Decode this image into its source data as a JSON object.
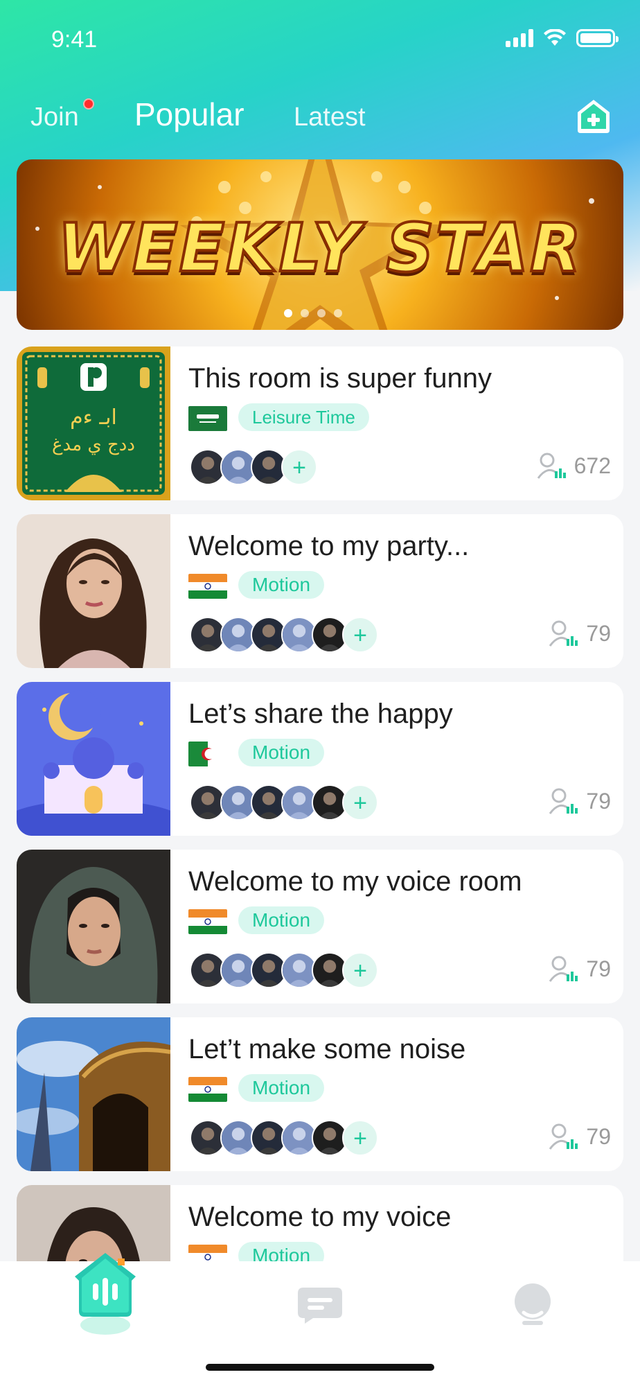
{
  "status_bar": {
    "time": "9:41"
  },
  "tabs": {
    "join": "Join",
    "popular": "Popular",
    "latest": "Latest"
  },
  "banner": {
    "text": "WEEKLY STAR",
    "slides": 4,
    "active_slide": 1
  },
  "rooms": [
    {
      "title": "This room is super funny",
      "flag": "saudi-arabia",
      "tag": "Leisure Time",
      "listeners": "672",
      "thumb": "green-arabic-poster"
    },
    {
      "title": "Welcome to my party...",
      "flag": "india",
      "tag": "Motion",
      "listeners": "79",
      "thumb": "woman-curly-hair"
    },
    {
      "title": "Let’s share the happy",
      "flag": "algeria",
      "tag": "Motion",
      "listeners": "79",
      "thumb": "purple-mosque"
    },
    {
      "title": "Welcome to my voice room",
      "flag": "india",
      "tag": "Motion",
      "listeners": "79",
      "thumb": "woman-headscarf"
    },
    {
      "title": "Let’t make some noise",
      "flag": "india",
      "tag": "Motion",
      "listeners": "79",
      "thumb": "golden-dome-sky"
    },
    {
      "title": "Welcome to my voice",
      "flag": "india",
      "tag": "Motion",
      "listeners": "",
      "thumb": "woman-portrait"
    }
  ],
  "bottom_nav": {
    "items": [
      {
        "name": "home",
        "icon": "home-voice-icon",
        "active": true
      },
      {
        "name": "messages",
        "icon": "chat-bubble-icon",
        "active": false
      },
      {
        "name": "profile",
        "icon": "profile-icon",
        "active": false
      }
    ]
  },
  "colors": {
    "accent": "#1ec89b",
    "tag_bg": "#d8f7ef",
    "badge_red": "#ff2d2d"
  }
}
